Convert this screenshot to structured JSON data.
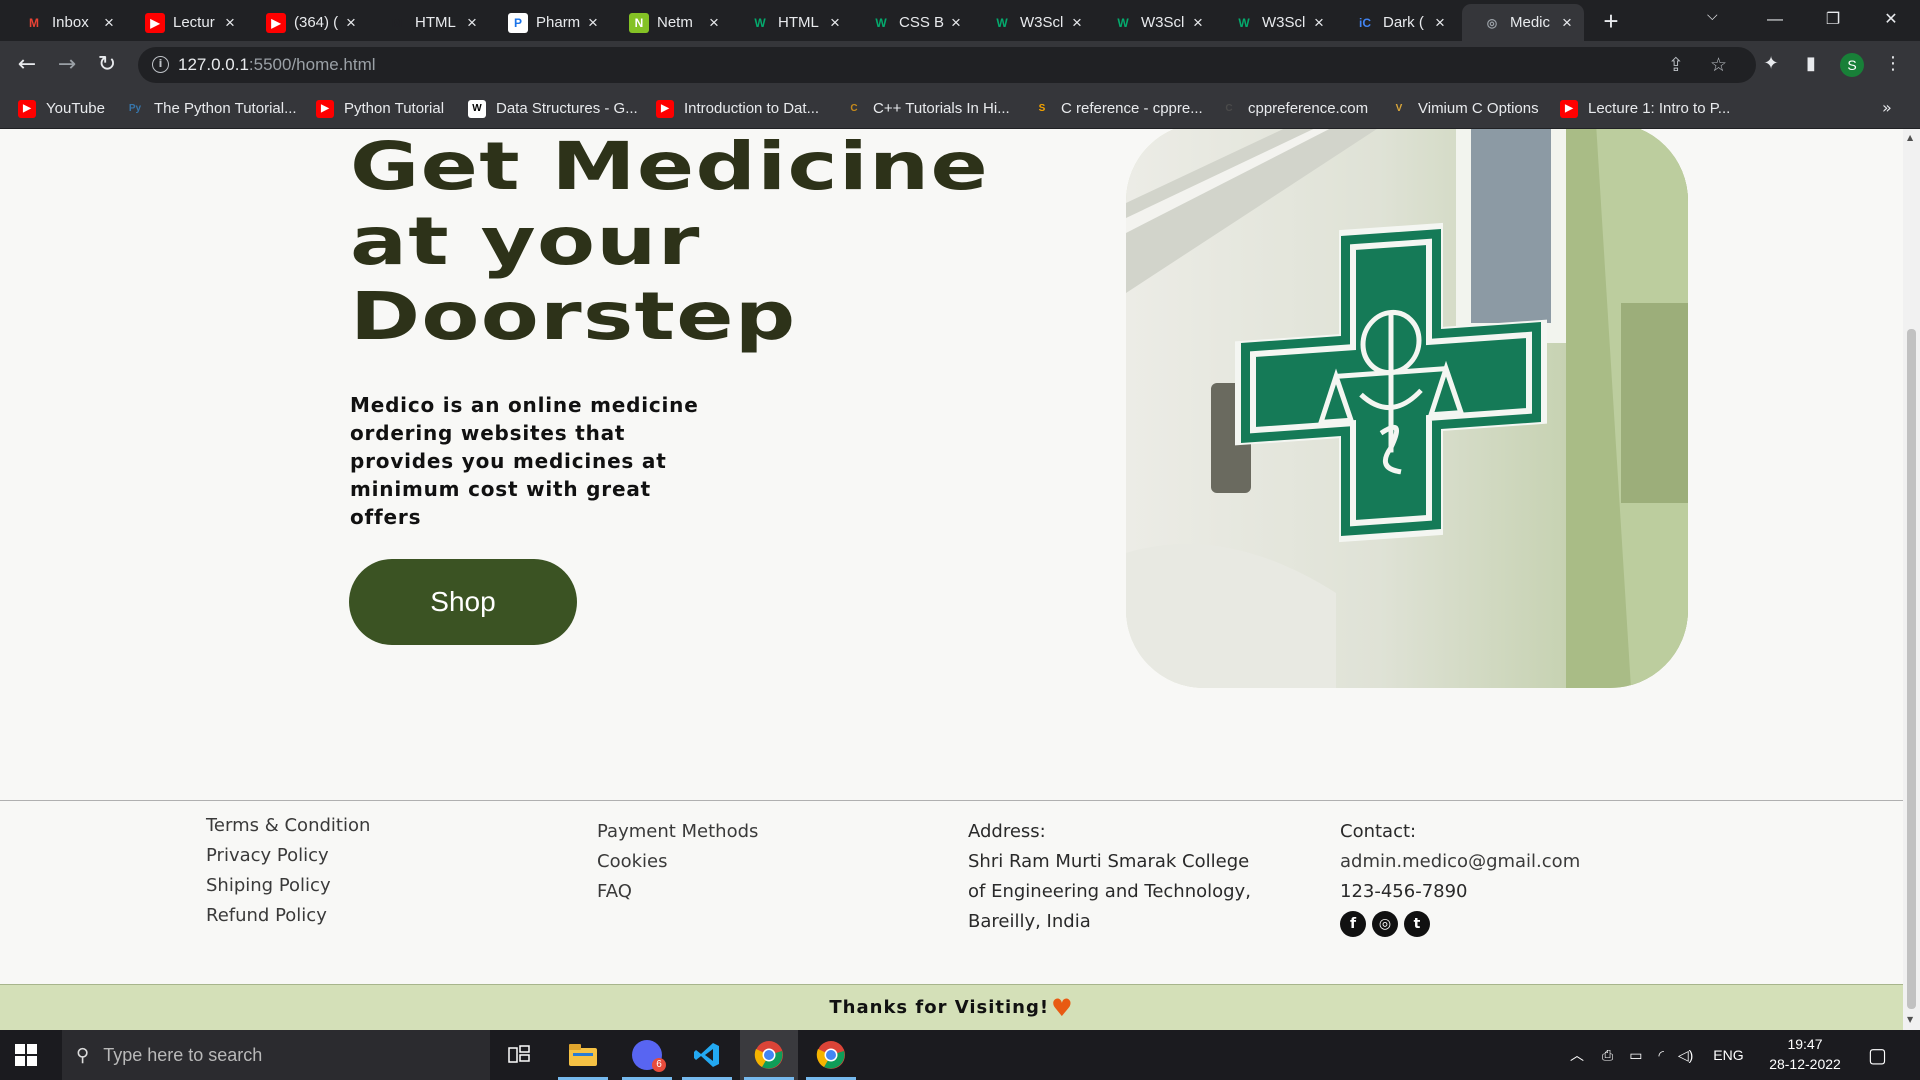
{
  "browser": {
    "tabs": [
      {
        "title": "Inbox",
        "icon": "gmail-icon",
        "color": "#ea4335",
        "glyph": "M"
      },
      {
        "title": "Lectur",
        "icon": "youtube-icon",
        "color": "#ff0000",
        "glyph": "▶"
      },
      {
        "title": "(364) (",
        "icon": "youtube-icon",
        "color": "#ff0000",
        "glyph": "▶"
      },
      {
        "title": "HTML",
        "icon": "medium-icon",
        "color": "#202124",
        "glyph": "M"
      },
      {
        "title": "Pharm",
        "icon": "pharmacy-icon",
        "color": "#ffffff",
        "glyph": "P"
      },
      {
        "title": "Netm",
        "icon": "netmeds-icon",
        "color": "#84c225",
        "glyph": "N"
      },
      {
        "title": "HTML",
        "icon": "w3schools-icon",
        "color": "#04aa6d",
        "glyph": "W"
      },
      {
        "title": "CSS B",
        "icon": "w3schools-icon",
        "color": "#04aa6d",
        "glyph": "W"
      },
      {
        "title": "W3Scl",
        "icon": "w3schools-icon",
        "color": "#04aa6d",
        "glyph": "W"
      },
      {
        "title": "W3Scl",
        "icon": "w3schools-icon",
        "color": "#04aa6d",
        "glyph": "W"
      },
      {
        "title": "W3Scl",
        "icon": "w3schools-icon",
        "color": "#04aa6d",
        "glyph": "W"
      },
      {
        "title": "Dark (",
        "icon": "ic-icon",
        "color": "#4285f4",
        "glyph": "iC"
      },
      {
        "title": "Medic",
        "icon": "globe-icon",
        "color": "#9aa0a6",
        "glyph": "◎"
      }
    ],
    "url_host": "127.0.0.1",
    "url_path": ":5500/home.html",
    "profile_initial": "S",
    "bookmarks": [
      {
        "title": "YouTube",
        "icon": "youtube-icon",
        "color": "#ff0000",
        "glyph": "▶"
      },
      {
        "title": "The Python Tutorial...",
        "icon": "python-icon",
        "color": "#3776ab",
        "glyph": "Py"
      },
      {
        "title": "Python Tutorial",
        "icon": "youtube-icon",
        "color": "#ff0000",
        "glyph": "▶"
      },
      {
        "title": "Data Structures - G...",
        "icon": "wikipedia-icon",
        "color": "#ffffff",
        "glyph": "W"
      },
      {
        "title": "Introduction to Dat...",
        "icon": "youtube-icon",
        "color": "#ff0000",
        "glyph": "▶"
      },
      {
        "title": "C++ Tutorials In Hi...",
        "icon": "cpp-icon",
        "color": "#c68a1b",
        "glyph": "C"
      },
      {
        "title": "C reference - cppre...",
        "icon": "cppref-icon",
        "color": "#f4a300",
        "glyph": "S"
      },
      {
        "title": "cppreference.com",
        "icon": "cppref-icon",
        "color": "#4a4a4a",
        "glyph": "C"
      },
      {
        "title": "Vimium C Options",
        "icon": "vimium-icon",
        "color": "#d9a63a",
        "glyph": "V"
      },
      {
        "title": "Lecture 1: Intro to P...",
        "icon": "youtube-icon",
        "color": "#ff0000",
        "glyph": "▶"
      }
    ]
  },
  "hero": {
    "title_line1": "Get Medicine",
    "title_line2": "at your",
    "title_line3": "Doorstep",
    "description": "Medico is an online medicine ordering websites that provides you medicines at minimum cost with great offers",
    "shop_label": "Shop",
    "accent": "#3b5323",
    "title_color": "#2d3219"
  },
  "footer": {
    "col1": [
      "Terms & Condition",
      "Privacy Policy",
      "Shiping Policy",
      "Refund Policy"
    ],
    "col2": [
      "Payment Methods",
      "Cookies",
      "FAQ"
    ],
    "address_heading": "Address:",
    "address_line1": "Shri Ram Murti Smarak College",
    "address_line2": "of Engineering and Technology,",
    "address_line3": "Bareilly, India",
    "contact_heading": "Contact:",
    "email": "admin.medico@gmail.com",
    "phone": "123-456-7890",
    "social": [
      "facebook-icon",
      "instagram-icon",
      "twitter-icon"
    ],
    "thanks": "Thanks for Visiting!",
    "thanks_bg": "#d4e0b8"
  },
  "taskbar": {
    "search_placeholder": "Type here to search",
    "language": "ENG",
    "time": "19:47",
    "date": "28-12-2022",
    "discord_badge": "6"
  }
}
